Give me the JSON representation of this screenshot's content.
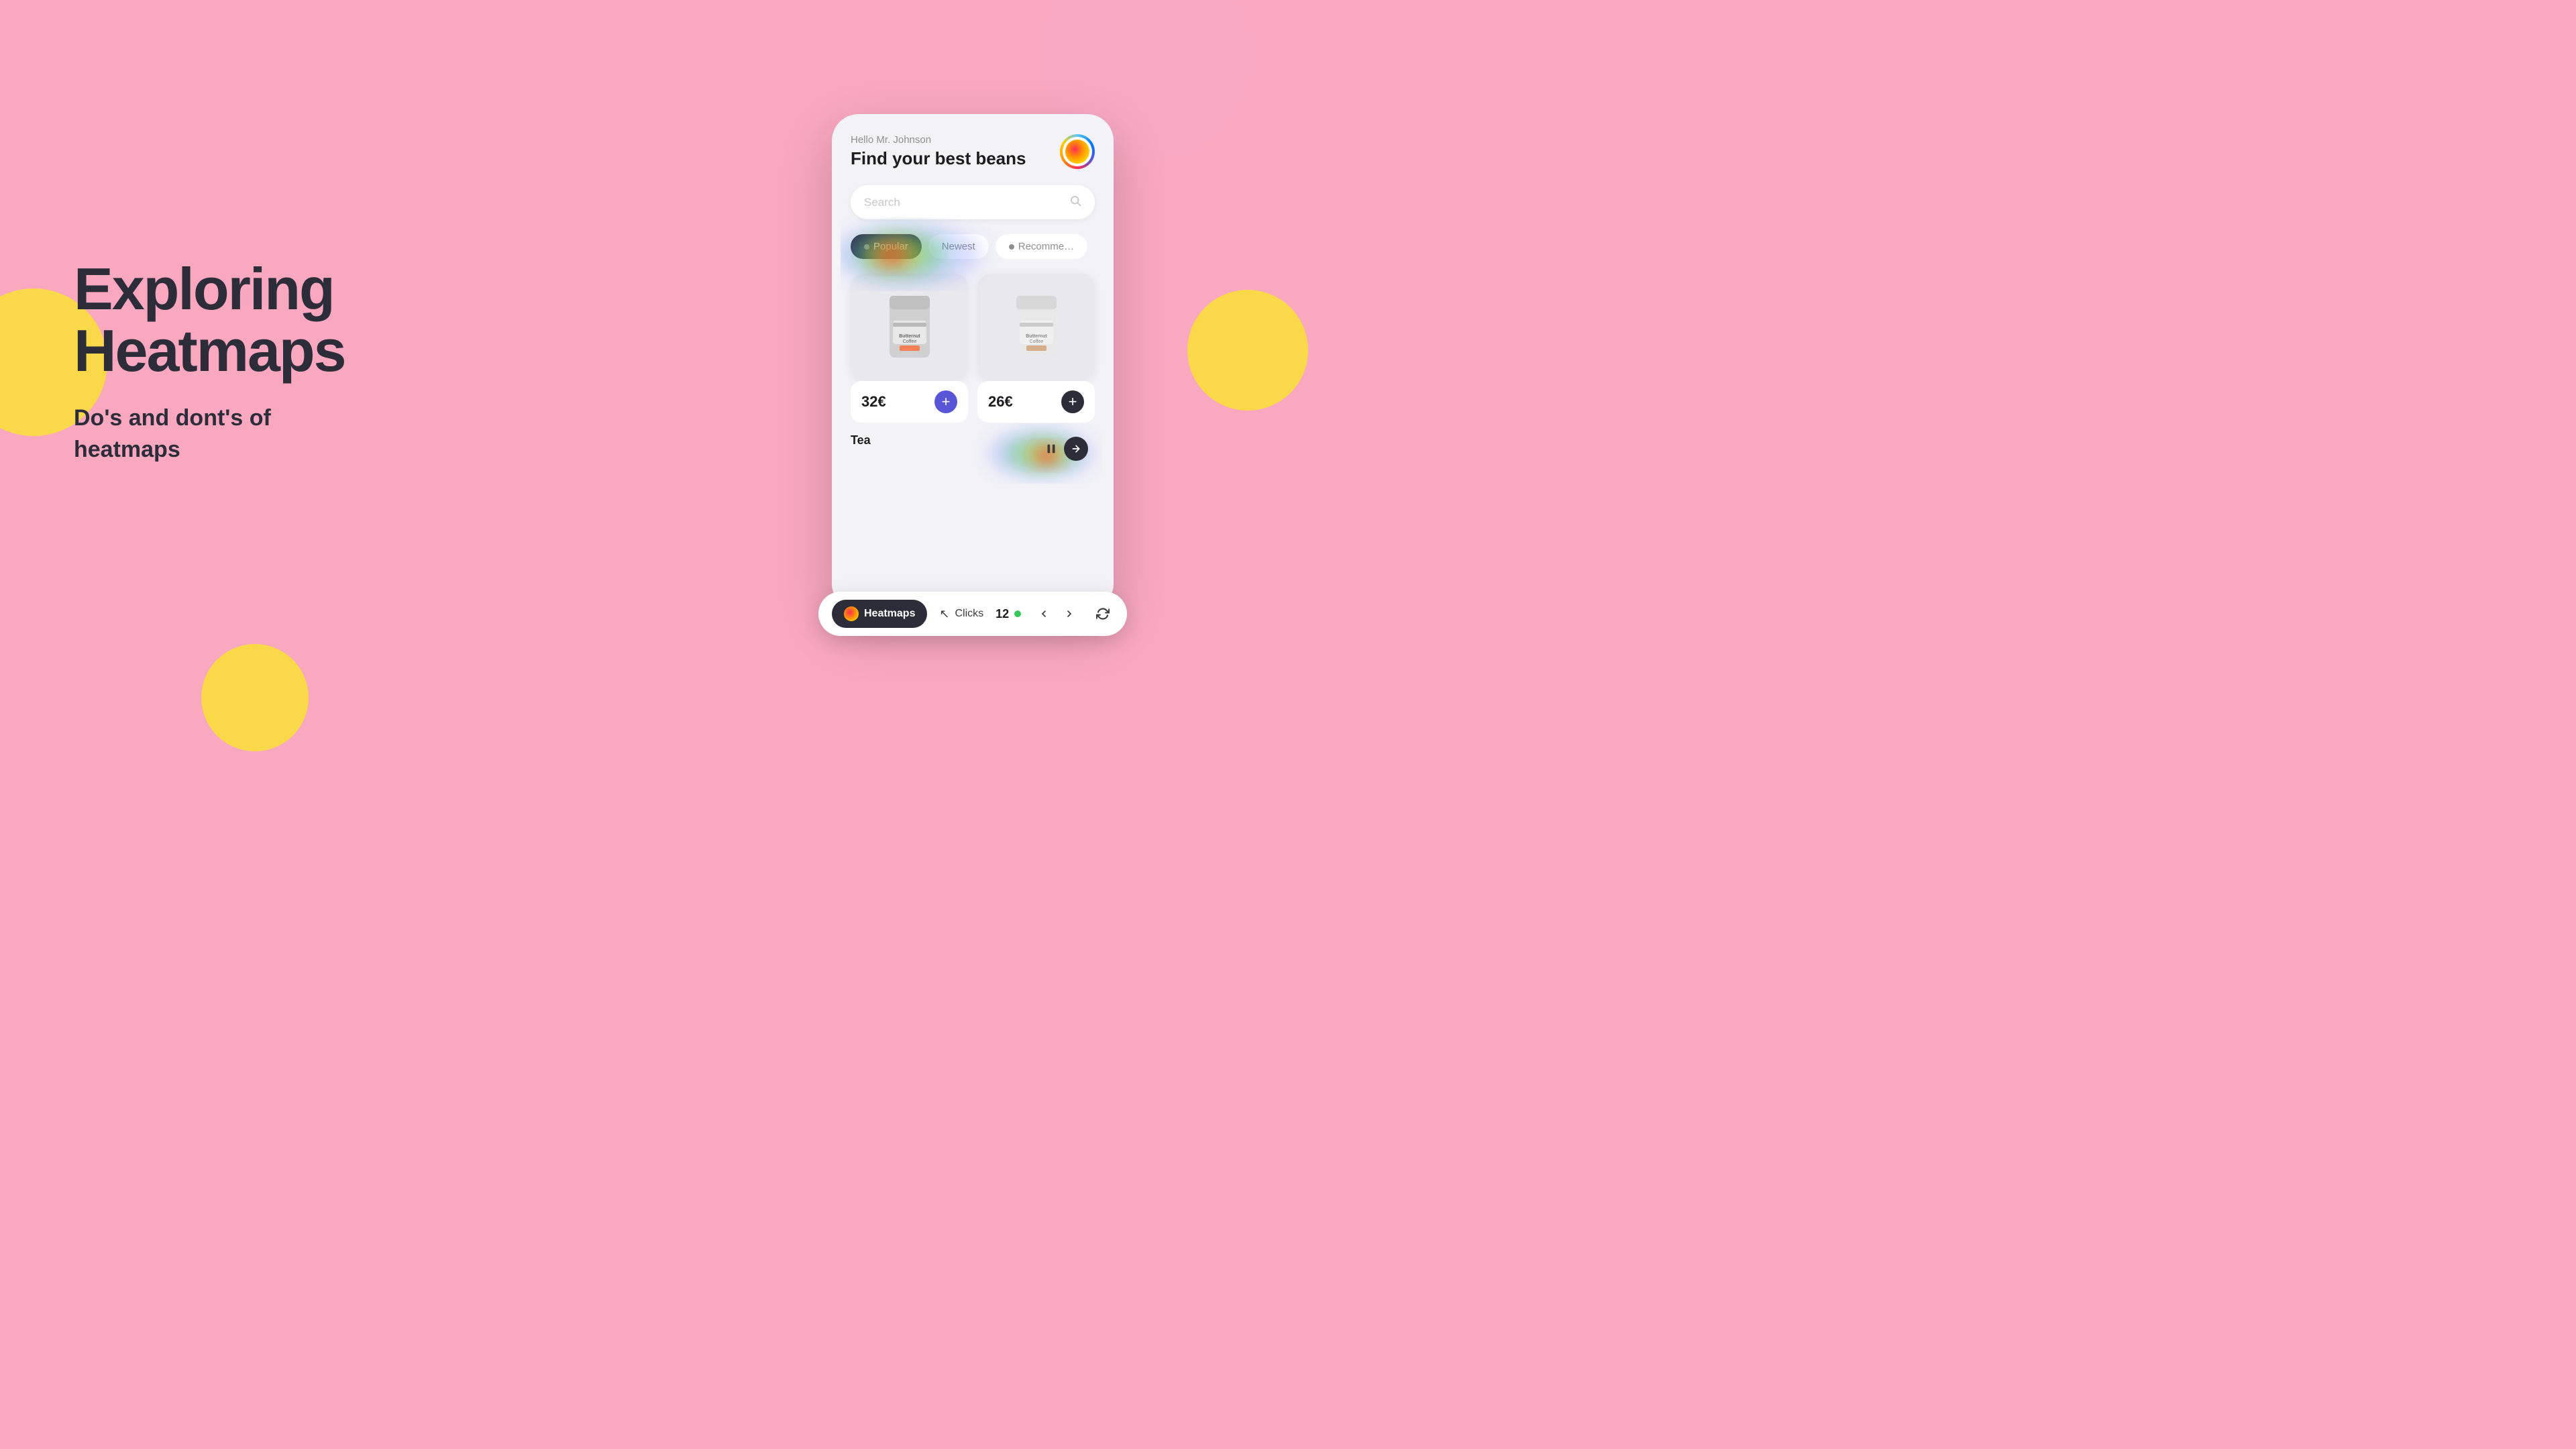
{
  "background": {
    "color": "#f9a8c0"
  },
  "left_panel": {
    "title_line1": "Exploring",
    "title_line2": "Heatmaps",
    "subtitle_line1": "Do's and dont's of",
    "subtitle_line2": "heatmaps"
  },
  "phone": {
    "greeting": "Hello Mr. Johnson",
    "header_title": "Find your best beans",
    "search_placeholder": "Search",
    "filter_tabs": [
      {
        "label": "Popular",
        "active": true,
        "has_dot": true
      },
      {
        "label": "Newest",
        "active": false,
        "has_dot": false
      },
      {
        "label": "Recommended",
        "active": false,
        "has_dot": true
      }
    ],
    "products": [
      {
        "price": "32€",
        "add_btn_color": "#5856d6"
      },
      {
        "price": "26€",
        "add_btn_color": "#2d2d3a"
      }
    ],
    "tea_section_label": "Tea"
  },
  "toolbar": {
    "heatmaps_label": "Heatmaps",
    "clicks_label": "Clicks",
    "count": "12",
    "count_active": true
  }
}
